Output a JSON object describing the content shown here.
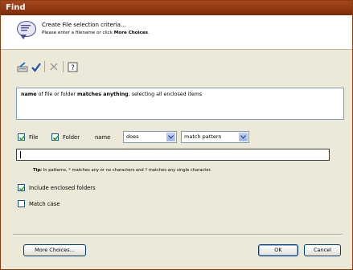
{
  "window": {
    "title": "Find"
  },
  "header": {
    "title": "Create File selection criteria...",
    "subtitle_prefix": "Please enter a filename or click ",
    "subtitle_bold": "More Choices",
    "subtitle_suffix": "."
  },
  "toolbar": {
    "icons": [
      "insert-icon",
      "check-icon",
      "delete-icon",
      "help-icon"
    ]
  },
  "description": {
    "part1": "name",
    "part2": " of file or folder ",
    "part3": "matches anything",
    "part4": ", selecting all enclosed items"
  },
  "criteria": {
    "file_label": "File",
    "file_checked": true,
    "folder_label": "Folder",
    "folder_checked": true,
    "name_label": "name",
    "operator_value": "does",
    "match_value": "match pattern"
  },
  "pattern": {
    "value": ""
  },
  "tip": {
    "label": "Tip:",
    "text": " In patterns, * matches any or no characters and ? matches any single character."
  },
  "options": {
    "include_label": "Include enclosed folders",
    "include_checked": true,
    "match_case_label": "Match case",
    "match_case_checked": false
  },
  "buttons": {
    "more_choices": "More Choices...",
    "ok": "OK",
    "cancel": "Cancel"
  },
  "colors": {
    "titlebar": "#8a3a12",
    "accent_blue": "#1c5180"
  }
}
